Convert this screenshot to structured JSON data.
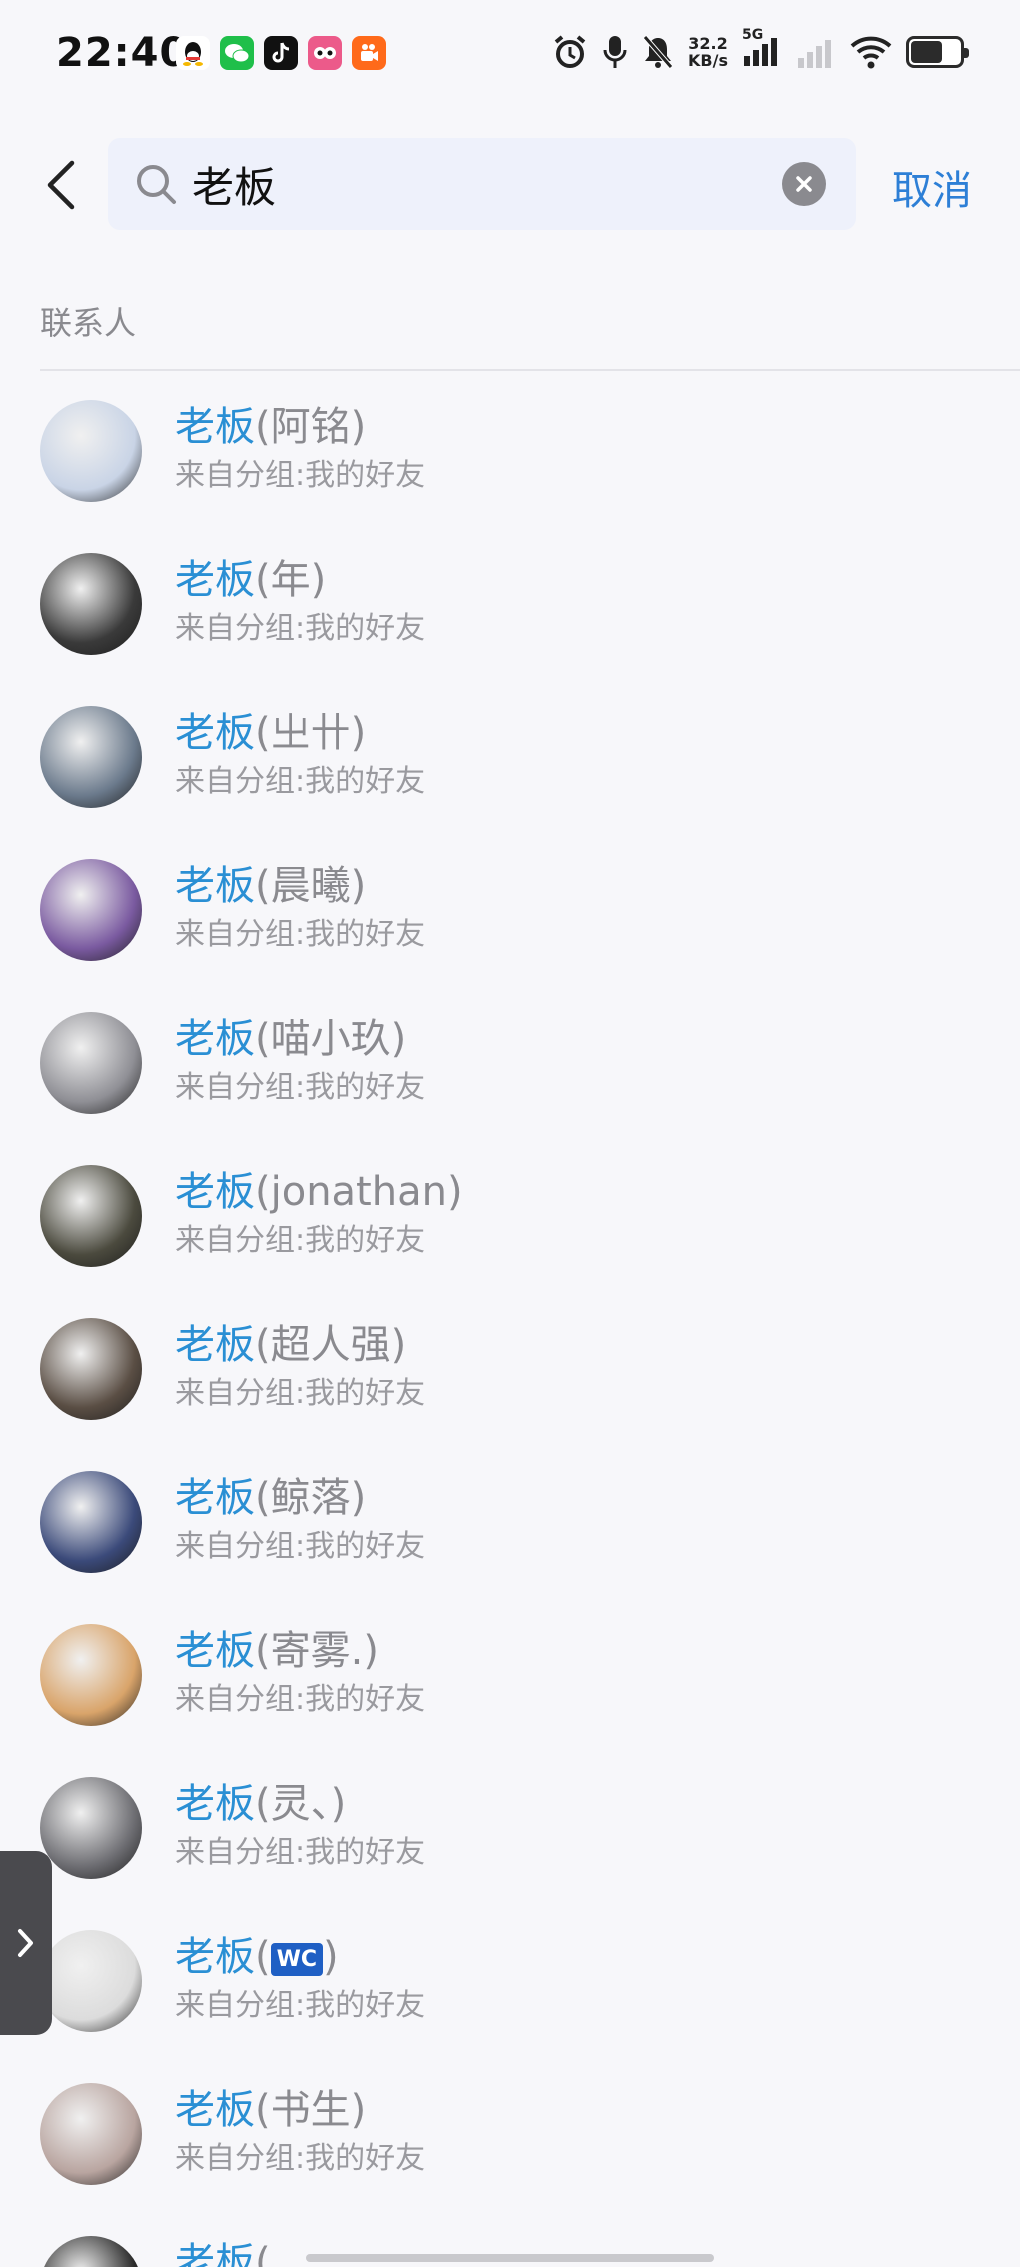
{
  "status_bar": {
    "time": "22:40",
    "speed_value": "32.2",
    "speed_unit": "KB/s",
    "network": "5G",
    "battery_level": 0.6,
    "app_icons": [
      "qq-icon",
      "wechat-icon",
      "tiktok-icon",
      "app-icon",
      "kuaishou-icon"
    ]
  },
  "search": {
    "query": "老板"
  },
  "header": {
    "cancel_label": "取消"
  },
  "section": {
    "title": "联系人"
  },
  "contacts": [
    {
      "highlight": "老板",
      "rest": "(阿铭)",
      "group": "来自分组:我的好友",
      "avatar_color": "#c9d4e6"
    },
    {
      "highlight": "老板",
      "rest": "(年)",
      "group": "来自分组:我的好友",
      "avatar_color": "#3a3a3a"
    },
    {
      "highlight": "老板",
      "rest": "(㞢卄)",
      "group": "来自分组:我的好友",
      "avatar_color": "#6b7a8c"
    },
    {
      "highlight": "老板",
      "rest": "(晨曦)",
      "group": "来自分组:我的好友",
      "avatar_color": "#7a5aa0"
    },
    {
      "highlight": "老板",
      "rest": "(喵小玖)",
      "group": "来自分组:我的好友",
      "avatar_color": "#8f8f95"
    },
    {
      "highlight": "老板",
      "rest": "(jonathan)",
      "group": "来自分组:我的好友",
      "avatar_color": "#4b4a3e"
    },
    {
      "highlight": "老板",
      "rest": "(超人强)",
      "group": "来自分组:我的好友",
      "avatar_color": "#5a4e44"
    },
    {
      "highlight": "老板",
      "rest": "(鲸落)",
      "group": "来自分组:我的好友",
      "avatar_color": "#3b4a7a"
    },
    {
      "highlight": "老板",
      "rest": "(寄雾.)",
      "group": "来自分组:我的好友",
      "avatar_color": "#d9a46a"
    },
    {
      "highlight": "老板",
      "rest": "(灵、)",
      "group": "来自分组:我的好友",
      "avatar_color": "#6d6d72"
    },
    {
      "highlight": "老板",
      "rest_open": "(",
      "badge": "WC",
      "rest_close": ")",
      "group": "来自分组:我的好友",
      "avatar_color": "#dcdcdc"
    },
    {
      "highlight": "老板",
      "rest": "(书生)",
      "group": "来自分组:我的好友",
      "avatar_color": "#b9a5a0"
    },
    {
      "highlight": "老板",
      "rest": "(",
      "group": "",
      "avatar_color": "#2a2a2a"
    }
  ],
  "colors": {
    "accent": "#2a8fd4",
    "cancel": "#2d7fd6",
    "secondary_text": "#8a8a8f"
  }
}
